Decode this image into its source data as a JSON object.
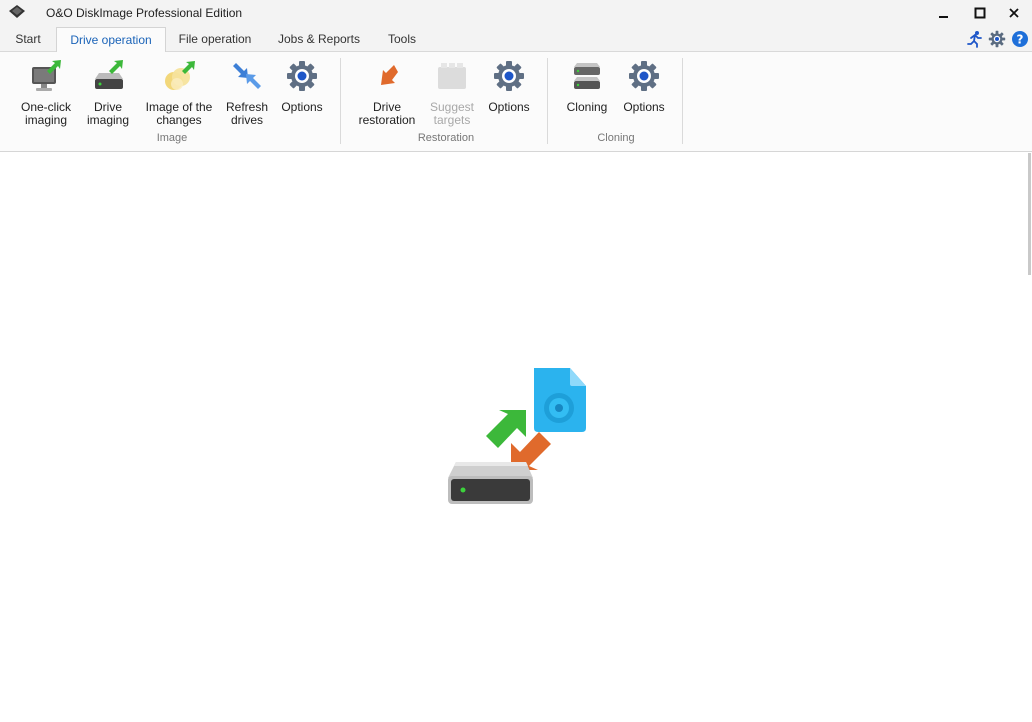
{
  "window": {
    "title": "O&O DiskImage Professional Edition",
    "controls": {
      "minimize": "minimize-icon",
      "maximize": "maximize-icon",
      "close": "close-icon"
    }
  },
  "tabs": [
    {
      "label": "Start",
      "active": false
    },
    {
      "label": "Drive operation",
      "active": true
    },
    {
      "label": "File operation",
      "active": false
    },
    {
      "label": "Jobs & Reports",
      "active": false
    },
    {
      "label": "Tools",
      "active": false
    }
  ],
  "toolbar_icons": [
    "runner-icon",
    "gear-icon",
    "help-icon"
  ],
  "ribbon": {
    "groups": [
      {
        "label": "Image",
        "buttons": [
          {
            "label": "One-click\nimaging",
            "icon": "monitor-arrow-icon"
          },
          {
            "label": "Drive\nimaging",
            "icon": "drive-arrow-icon"
          },
          {
            "label": "Image of the\nchanges",
            "icon": "coins-arrow-icon"
          },
          {
            "label": "Refresh\ndrives",
            "icon": "refresh-arrows-icon"
          },
          {
            "label": "Options",
            "icon": "gear-icon"
          }
        ]
      },
      {
        "label": "Restoration",
        "buttons": [
          {
            "label": "Drive\nrestoration",
            "icon": "restore-arrow-icon"
          },
          {
            "label": "Suggest\ntargets",
            "icon": "suggest-targets-icon",
            "disabled": true
          },
          {
            "label": "Options",
            "icon": "gear-icon"
          }
        ]
      },
      {
        "label": "Cloning",
        "buttons": [
          {
            "label": "Cloning",
            "icon": "clone-drives-icon"
          },
          {
            "label": "Options",
            "icon": "gear-icon"
          }
        ]
      }
    ]
  },
  "colors": {
    "accent": "#1a63b8",
    "green_arrow": "#3cb83a",
    "orange_arrow": "#e06a2c",
    "disk_blue": "#2bb3ee",
    "gear_blue": "#1e56c8"
  },
  "hero_icon": "drive-image-restore-illustration"
}
